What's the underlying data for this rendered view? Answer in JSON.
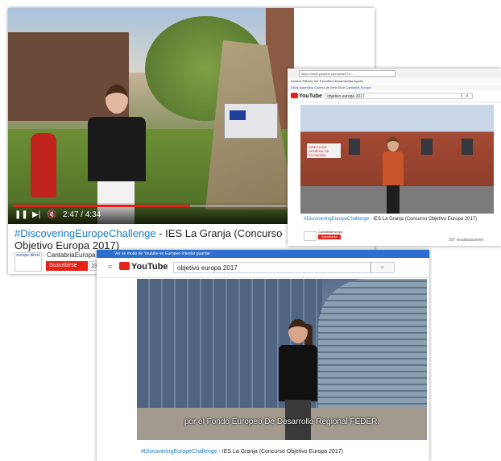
{
  "shot1": {
    "video_time": "2:47 / 4:34",
    "progress_fraction": 0.64,
    "title_tag": "#DiscoveringEuropeChallenge",
    "title_rest": " - IES La Granja (Concurso Objetivo Europa 2017)",
    "channel_name": "CantabriaEuropa",
    "channel_logo_text": "europe direct",
    "subscribe_label": "Suscribirse",
    "subscriber_count": "23"
  },
  "shot2": {
    "url_text": "https://www.youtube.com/watch?v=...",
    "menu_text": "Archivo  Edición  Ver  Favoritos  Herramientas  Ayuda",
    "fav_text": "Sitios sugeridos  Galería de Web Slice  Cantabria Europa",
    "yt_logo": "YouTube",
    "search_query": "objetivo europa 2017",
    "sign_text": "DIRECCIÓN GENERAL DE ECONOMÍA",
    "title_tag": "#DiscoveringEuropeChallenge",
    "title_rest": " - IES La Granja (Concurso Objetivo Europa 2017)",
    "channel_name": "CantabriaEuropa",
    "subscribe_label": "Suscribirse",
    "views": "207 visualizaciones"
  },
  "shot3": {
    "topbar_text": "Ver en modo de Youtube en Europeo   Intentar guardar",
    "yt_logo": "YouTube",
    "search_query": "objetivo europa 2017",
    "caption": "por el Fondo Europeo De Desarrollo Regional FEDER.",
    "title_tag": "#DiscoveringEuropeChallenge",
    "title_rest": " - IES La Granja (Concurso Objetivo Europa 2017)"
  },
  "colors": {
    "youtube_red": "#e62117",
    "link_blue": "#167ac6",
    "topbar_blue": "#2c6fd1"
  }
}
